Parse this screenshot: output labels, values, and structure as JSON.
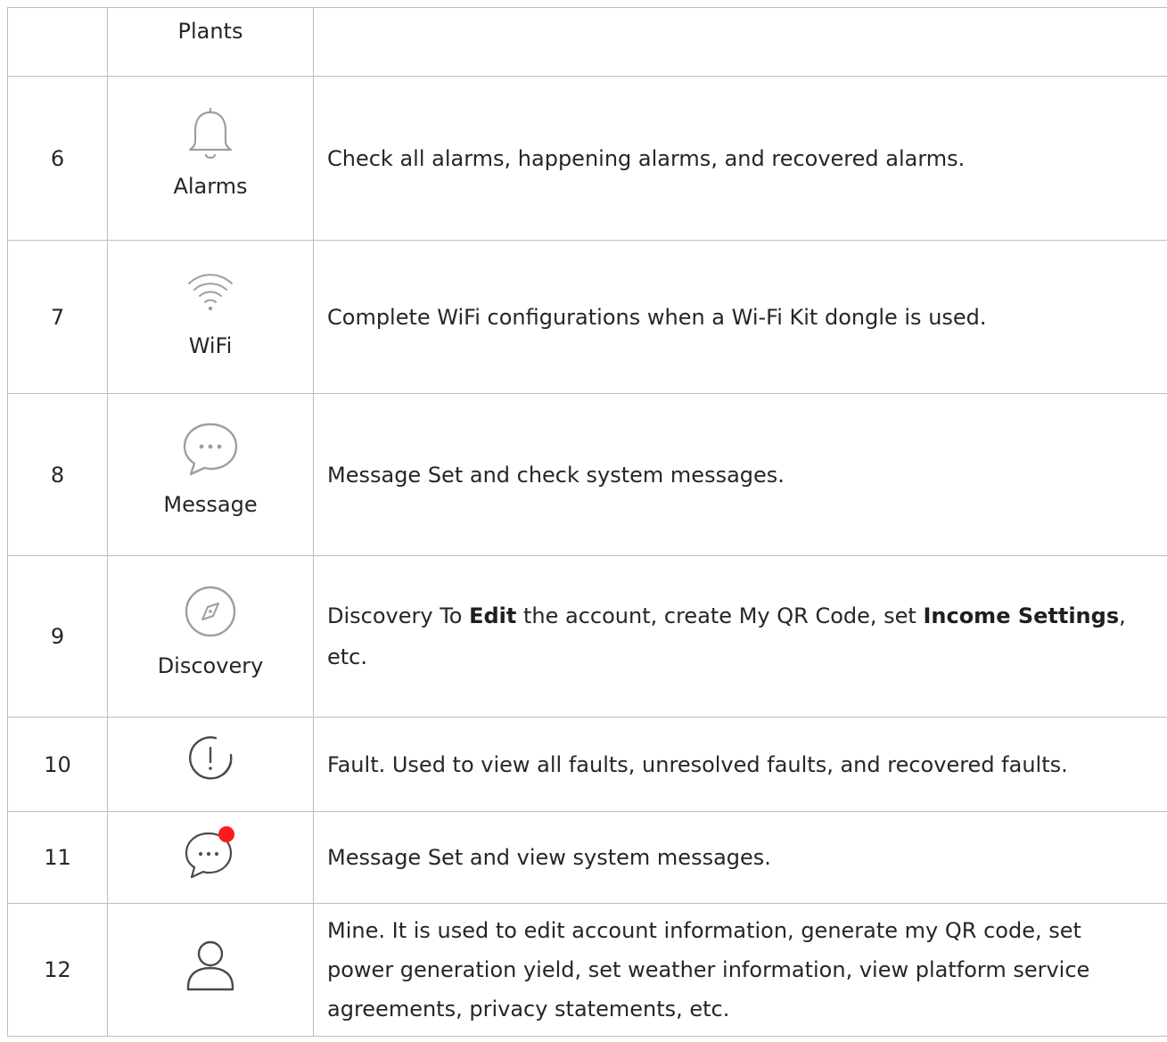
{
  "rows": [
    {
      "num": "",
      "label": "Plants",
      "icon": "none",
      "desc": ""
    },
    {
      "num": "6",
      "label": "Alarms",
      "icon": "bell-icon",
      "desc": "Check all alarms, happening alarms, and recovered alarms."
    },
    {
      "num": "7",
      "label": "WiFi",
      "icon": "wifi-icon",
      "desc": "Complete WiFi configurations when a Wi-Fi Kit dongle is used."
    },
    {
      "num": "8",
      "label": "Message",
      "icon": "message-icon",
      "desc": "Message Set and check system messages."
    },
    {
      "num": "9",
      "label": "Discovery",
      "icon": "compass-icon",
      "desc_parts": {
        "a": "Discovery To ",
        "b_edit": "Edit",
        "c": " the account,  create My QR Code,  set ",
        "d_income": "Income Settings",
        "e": ",",
        "f": "etc."
      }
    },
    {
      "num": "10",
      "label": "",
      "icon": "fault-icon",
      "desc": "Fault. Used to view all faults, unresolved faults, and recovered faults."
    },
    {
      "num": "11",
      "label": "",
      "icon": "message-badge-icon",
      "desc": "Message Set and view system messages."
    },
    {
      "num": "12",
      "label": "",
      "icon": "user-icon",
      "desc_lines": [
        "Mine. It is used to edit account information,  generate my QR code,  set",
        "power generation yield,  set weather information,  view platform service",
        "agreements,  privacy statements,  etc."
      ]
    }
  ],
  "colors": {
    "border": "#bdbdbd",
    "icon": "#9e9e9e",
    "badge": "#ff1a1a",
    "text": "#262626"
  }
}
